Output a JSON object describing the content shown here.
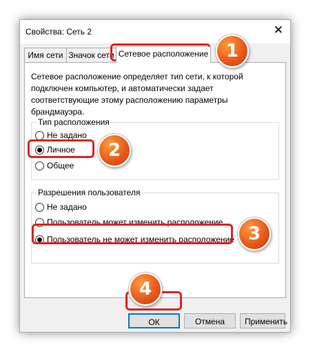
{
  "window": {
    "title": "Свойства: Сеть 2",
    "close_glyph": "✕"
  },
  "tabs": [
    {
      "label": "Имя сети"
    },
    {
      "label": "Значок сети"
    },
    {
      "label": "Сетевое расположение"
    }
  ],
  "description": "Сетевое расположение определяет тип сети, к которой подключен компьютер, и автоматически задает соответствующие этому расположению параметры брандмауэра.",
  "location_group": {
    "label": "Тип расположения",
    "options": [
      {
        "label": "Не задано",
        "checked": false
      },
      {
        "label": "Личное",
        "checked": true
      },
      {
        "label": "Общее",
        "checked": false
      }
    ]
  },
  "permissions_group": {
    "label": "Разрешения пользователя",
    "options": [
      {
        "label": "Не задано",
        "checked": false
      },
      {
        "label": "Пользователь может изменить расположение",
        "checked": false
      },
      {
        "label": "Пользователь не может изменить расположение",
        "checked": true
      }
    ]
  },
  "buttons": {
    "ok": "ОК",
    "cancel": "Отмена",
    "apply": "Применить"
  },
  "annotations": [
    "1",
    "2",
    "3",
    "4"
  ],
  "colors": {
    "highlight": "#e02222",
    "badge": "#e4561a"
  }
}
